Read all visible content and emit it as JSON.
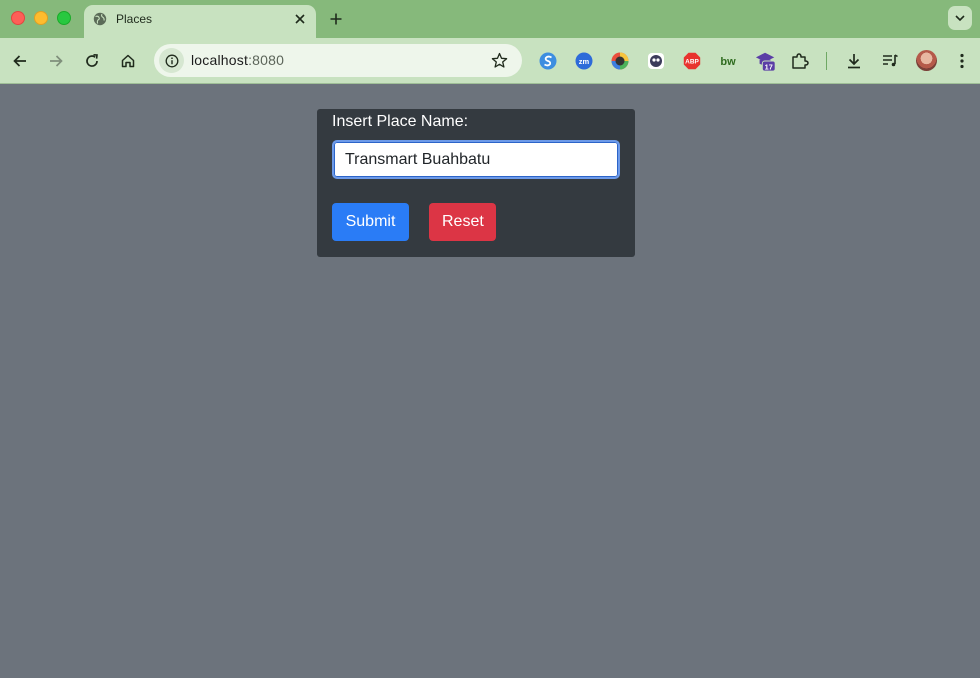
{
  "window": {
    "traffic_lights": [
      "close",
      "minimize",
      "maximize"
    ]
  },
  "tab": {
    "title": "Places",
    "icon": "globe-icon"
  },
  "address_bar": {
    "host": "localhost",
    "port": ":8080"
  },
  "extensions": [
    {
      "name": "s-extension-icon"
    },
    {
      "name": "zoom-extension-icon",
      "label": "zm"
    },
    {
      "name": "color-picker-extension-icon"
    },
    {
      "name": "mascot-extension-icon"
    },
    {
      "name": "adblock-plus-extension-icon",
      "label": "ABP"
    },
    {
      "name": "bw-extension-icon",
      "label": "bw"
    },
    {
      "name": "graduation-cap-extension-icon",
      "badge": "17"
    },
    {
      "name": "puzzle-extensions-icon"
    }
  ],
  "form": {
    "label": "Insert Place Name:",
    "place_value": "Transmart Buahbatu",
    "submit_label": "Submit",
    "reset_label": "Reset"
  },
  "colors": {
    "page_background": "#6c737c",
    "panel_background": "#343a40",
    "submit": "#2a7cf6",
    "reset": "#dc3545",
    "chrome": "#86b97b"
  }
}
